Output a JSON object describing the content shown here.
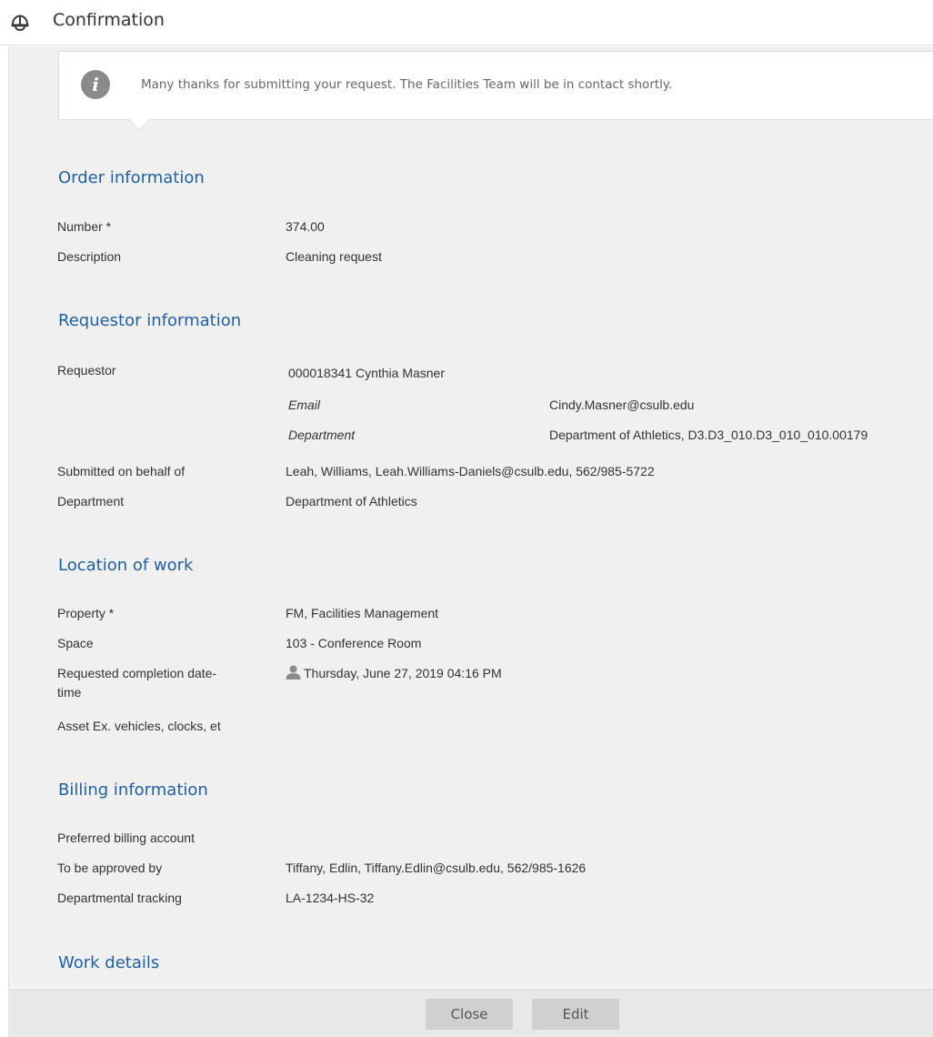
{
  "header": {
    "title": "Confirmation",
    "icon": "hard-hat-icon"
  },
  "info": {
    "icon": "info-icon",
    "message": "Many thanks for submitting your request. The Facilities Team will be in contact shortly."
  },
  "order": {
    "title": "Order information",
    "number_label": "Number *",
    "number_value": "374.00",
    "description_label": "Description",
    "description_value": "Cleaning request"
  },
  "requestor": {
    "title": "Requestor information",
    "requestor_label": "Requestor",
    "requestor_value": "000018341 Cynthia Masner",
    "email_label": "Email",
    "email_value": "Cindy.Masner@csulb.edu",
    "department_label": "Department",
    "department_value": "Department of Athletics, D3.D3_010.D3_010_010.00179",
    "behalf_label": "Submitted on behalf of",
    "behalf_value": "Leah, Williams, Leah.Williams-Daniels@csulb.edu, 562/985-5722",
    "dept_label": "Department",
    "dept_value": "Department of Athletics"
  },
  "location": {
    "title": "Location of work",
    "property_label": "Property *",
    "property_value": "FM, Facilities Management",
    "space_label": "Space",
    "space_value": "103 - Conference Room",
    "completion_label_1": "Requested completion date-",
    "completion_label_2": "time",
    "completion_value": "Thursday, June 27, 2019 04:16 PM",
    "asset_label": "Asset Ex. vehicles, clocks, et"
  },
  "billing": {
    "title": "Billing information",
    "preferred_label": "Preferred billing account",
    "approved_label": "To be approved by",
    "approved_value": "Tiffany, Edlin, Tiffany.Edlin@csulb.edu, 562/985-1626",
    "tracking_label": "Departmental tracking",
    "tracking_value": "LA-1234-HS-32"
  },
  "work": {
    "title": "Work details"
  },
  "footer": {
    "close_label": "Close",
    "edit_label": "Edit"
  },
  "colors": {
    "accent": "#1f5fa4",
    "panel": "#f0f0f0",
    "button": "#d0d0d0"
  }
}
